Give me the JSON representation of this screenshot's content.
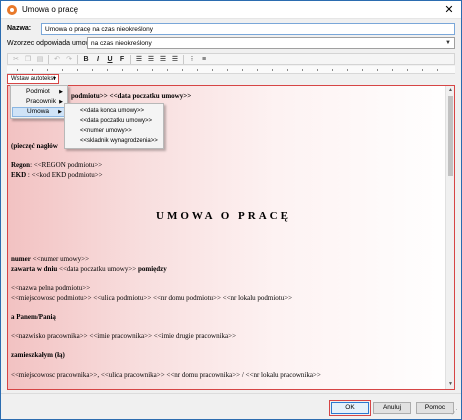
{
  "window": {
    "title": "Umowa o pracę",
    "close_glyph": "✕"
  },
  "form": {
    "name_label": "Nazwa:",
    "name_value": "Umowa o pracę na czas nieokreślony",
    "template_label": "Wzorzec odpowiada umowie:",
    "template_value": "na czas nieokreślony"
  },
  "toolbar": {
    "buttons": [
      "cut-icon",
      "copy-icon",
      "paste-icon",
      "undo-icon",
      "redo-icon",
      "bold-icon",
      "italic-icon",
      "underline-icon",
      "font-icon",
      "align-left-icon",
      "align-center-icon",
      "align-right-icon",
      "justify-icon",
      "bullets-icon",
      "numbering-icon"
    ],
    "bold": "B",
    "italic": "I",
    "underline": "U",
    "font": "F"
  },
  "autotext": {
    "label": "Wstaw autotekst",
    "menu": [
      {
        "label": "Podmiot"
      },
      {
        "label": "Pracownik"
      },
      {
        "label": "Umowa"
      }
    ],
    "submenu": [
      {
        "label": "<<data konca umowy>>"
      },
      {
        "label": "<<data poczatku umowy>>"
      },
      {
        "label": "<<numer umowy>>"
      },
      {
        "label": "<<skladnik wynagrodzenia>>"
      }
    ]
  },
  "document": {
    "line1": "podmiotu>> <<data poczatku umowy>>",
    "line2": "(pieczęć nagłów",
    "regon_label": "Regon",
    "regon_value": ": <<REGON podmiotu>>",
    "ekd_label": "EKD",
    "ekd_value": " : <<kod EKD podmiotu>>",
    "heading": "UMOWA O PRACĘ",
    "numer_label": "numer",
    "numer_value": " <<numer umowy>>",
    "zawarta": "zawarta w dniu",
    "zawarta_mid": " <<data poczatku umowy>> ",
    "pomiedzy": "pomiędzy",
    "line_nazwa": "<<nazwa pelna podmiotu>>",
    "line_adres_podmiot": "<<miejscowosc podmiotu>> <<ulica podmiotu>> <<nr domu podmiotu>> <<nr lokalu podmiotu>>",
    "line_panem": "a Panem/Panią",
    "line_pracownik": "<<nazwisko pracownika>> <<imie pracownika>> <<imie drugie pracownika>>",
    "line_zamieszkalym": "zamieszkałym (łą)",
    "line_adres_pracownik": "<<miejscowosc pracownika>>, <<ulica pracownika>> <<nr domu pracownika>> / <<nr lokalu pracownika>>"
  },
  "buttons": {
    "ok": "OK",
    "cancel": "Anuluj",
    "help": "Pomoc"
  },
  "colors": {
    "highlight_border": "#d64545",
    "field_border": "#7aa7d9",
    "menu_active": "#cfe3f7",
    "app_icon": "#e8792a"
  }
}
